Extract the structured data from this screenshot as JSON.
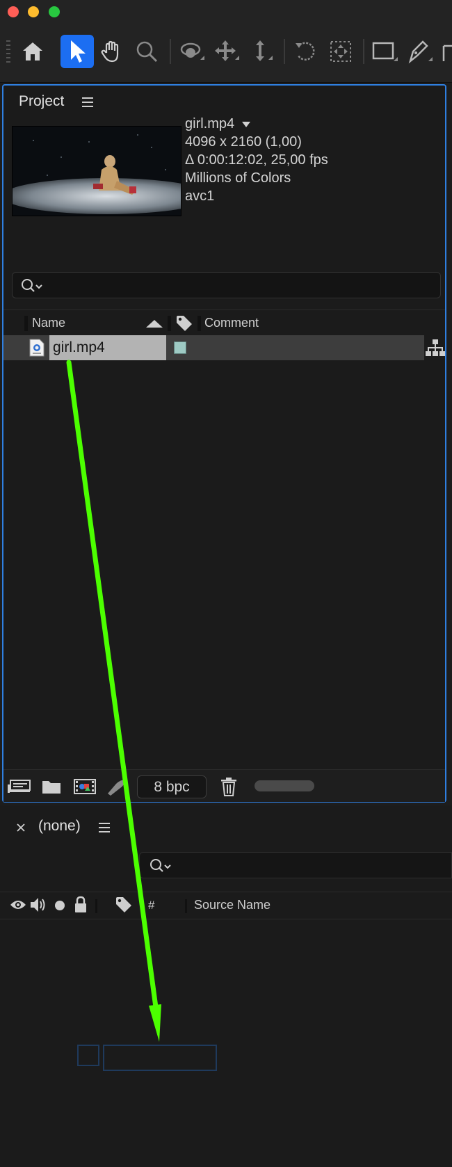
{
  "window": {
    "traffic_lights": [
      "close-button",
      "minimize-button",
      "zoom-button"
    ],
    "traffic_colors": [
      "#ff5f57",
      "#febc2e",
      "#28c840"
    ]
  },
  "toolbar": {
    "tools": [
      "home-icon",
      "selection-tool",
      "hand-tool",
      "zoom-tool",
      "orbit-camera-tool",
      "pan-camera-tool",
      "dolly-camera-tool",
      "rotation-tool",
      "pan-behind-tool",
      "rectangle-tool",
      "pen-tool"
    ],
    "active_tool": "selection-tool",
    "accent": "#1c6ef2"
  },
  "project": {
    "title": "Project",
    "footage": {
      "name": "girl.mp4",
      "dimensions": "4096 x 2160 (1,00)",
      "duration": "Δ 0:00:12:02, 25,00 fps",
      "colors": "Millions of Colors",
      "codec": "avc1"
    },
    "columns": {
      "name": "Name",
      "comment": "Comment"
    },
    "items": [
      {
        "name": "girl.mp4",
        "label_color": "#9ecac4"
      }
    ],
    "bit_depth": "8 bpc",
    "border_color": "#2f7fe0"
  },
  "timeline": {
    "comp_name": "(none)",
    "columns": {
      "hash": "#",
      "source_name": "Source Name"
    }
  },
  "annotation": {
    "arrow_color": "#4cff00"
  }
}
